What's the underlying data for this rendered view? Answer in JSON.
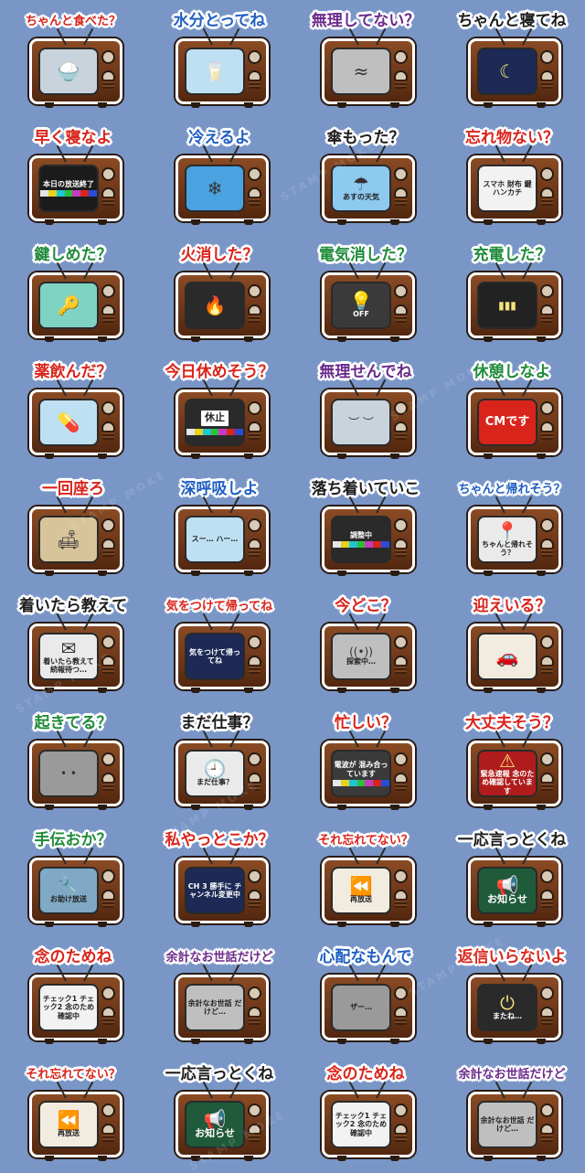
{
  "watermark": "STAMP MOKE",
  "colors": {
    "background": "#7996c7",
    "tv_body": "#6b3618",
    "caption_red": "#d9241b",
    "caption_blue": "#1f5fc2",
    "caption_green": "#1f8a3a",
    "caption_purple": "#6a2a8a"
  },
  "stickers": [
    {
      "caption": "ちゃんと食べた？",
      "accent": "#d9241b",
      "screen_bg": "#c9d3dc",
      "screen_icon": "rice-bowl-icon",
      "glyph": "🍚",
      "screen_text": ""
    },
    {
      "caption": "水分とってね",
      "accent": "#1f5fc2",
      "screen_bg": "#bfe0f2",
      "screen_icon": "water-glass-icon",
      "glyph": "🥛",
      "screen_text": ""
    },
    {
      "caption": "無理してない？",
      "accent": "#6a2a8a",
      "screen_bg": "#bfbfbf",
      "screen_icon": "worried-face-icon",
      "glyph": "≈",
      "screen_text": ""
    },
    {
      "caption": "ちゃんと寝てね",
      "accent": "#1d1d1d",
      "screen_bg": "#1c2a55",
      "screen_icon": "moon-icon",
      "glyph": "☾",
      "screen_text": ""
    },
    {
      "caption": "早く寝なよ",
      "accent": "#d9241b",
      "screen_bg": "#1b1b1b",
      "screen_icon": "broadcast-end-icon",
      "glyph": "",
      "screen_text": "本日の放送終了"
    },
    {
      "caption": "冷えるよ",
      "accent": "#1f5fc2",
      "screen_bg": "#4aa3e0",
      "screen_icon": "snowflake-icon",
      "glyph": "❄",
      "screen_text": ""
    },
    {
      "caption": "傘もった？",
      "accent": "#1d1d1d",
      "screen_bg": "#8ec9ef",
      "screen_icon": "umbrella-weather-icon",
      "glyph": "☂",
      "screen_text": "あすの天気"
    },
    {
      "caption": "忘れ物ない？",
      "accent": "#d9241b",
      "screen_bg": "#f2f2f2",
      "screen_icon": "checklist-icon",
      "glyph": "",
      "screen_text": "スマホ 財布 鍵 ハンカチ"
    },
    {
      "caption": "鍵しめた？",
      "accent": "#1f8a3a",
      "screen_bg": "#7fd3c3",
      "screen_icon": "key-icon",
      "glyph": "🔑",
      "screen_text": ""
    },
    {
      "caption": "火消した？",
      "accent": "#d9241b",
      "screen_bg": "#2a2a2a",
      "screen_icon": "gas-flame-icon",
      "glyph": "🔥",
      "screen_text": ""
    },
    {
      "caption": "電気消した？",
      "accent": "#1f8a3a",
      "screen_bg": "#3a3a3a",
      "screen_icon": "ceiling-lamp-icon",
      "glyph": "💡",
      "screen_text": "OFF"
    },
    {
      "caption": "充電した？",
      "accent": "#1f8a3a",
      "screen_bg": "#222222",
      "screen_icon": "battery-icon",
      "glyph": "▮▮▮",
      "screen_text": ""
    },
    {
      "caption": "薬飲んだ？",
      "accent": "#d9241b",
      "screen_bg": "#bfe0f2",
      "screen_icon": "medicine-icon",
      "glyph": "💊",
      "screen_text": ""
    },
    {
      "caption": "今日休めそう？",
      "accent": "#d9241b",
      "screen_bg": "#2a2a2a",
      "screen_icon": "rest-sign-icon",
      "glyph": "",
      "screen_text": "休止"
    },
    {
      "caption": "無理せんでね",
      "accent": "#6a2a8a",
      "screen_bg": "#c9d3dc",
      "screen_icon": "calm-face-icon",
      "glyph": "︶ ︶",
      "screen_text": ""
    },
    {
      "caption": "休憩しなよ",
      "accent": "#1f8a3a",
      "screen_bg": "#d9241b",
      "screen_icon": "commercial-icon",
      "glyph": "",
      "screen_text": "CMです"
    },
    {
      "caption": "一回座ろ",
      "accent": "#d9241b",
      "screen_bg": "#d8c49a",
      "screen_icon": "sofa-icon",
      "glyph": "🛋",
      "screen_text": ""
    },
    {
      "caption": "深呼吸しよ",
      "accent": "#1f5fc2",
      "screen_bg": "#bfe0f2",
      "screen_icon": "breathing-face-icon",
      "glyph": "",
      "screen_text": "スー… ハー…"
    },
    {
      "caption": "落ち着いていこ",
      "accent": "#1d1d1d",
      "screen_bg": "#2a2a2a",
      "screen_icon": "adjusting-icon",
      "glyph": "",
      "screen_text": "調整中"
    },
    {
      "caption": "ちゃんと帰れそう？",
      "accent": "#1f5fc2",
      "screen_bg": "#eaeaea",
      "screen_icon": "map-icon",
      "glyph": "📍",
      "screen_text": "ちゃんと帰れそう？"
    },
    {
      "caption": "着いたら教えて",
      "accent": "#1d1d1d",
      "screen_bg": "#eaeaea",
      "screen_icon": "mail-icon",
      "glyph": "✉",
      "screen_text": "着いたら教えて 続報待つ…"
    },
    {
      "caption": "気をつけて帰ってね",
      "accent": "#d9241b",
      "screen_bg": "#1c2a55",
      "screen_icon": "news-night-icon",
      "glyph": "",
      "screen_text": "気をつけて帰ってね"
    },
    {
      "caption": "今どこ？",
      "accent": "#d9241b",
      "screen_bg": "#bfbfbf",
      "screen_icon": "signal-icon",
      "glyph": "((•))",
      "screen_text": "探索中…"
    },
    {
      "caption": "迎えいる？",
      "accent": "#d9241b",
      "screen_bg": "#f2ece0",
      "screen_icon": "car-icon",
      "glyph": "🚗",
      "screen_text": ""
    },
    {
      "caption": "起きてる？",
      "accent": "#1f8a3a",
      "screen_bg": "#9a9a9a",
      "screen_icon": "eyes-icon",
      "glyph": "• •",
      "screen_text": ""
    },
    {
      "caption": "まだ仕事？",
      "accent": "#1d1d1d",
      "screen_bg": "#eaeaea",
      "screen_icon": "clock-icon",
      "glyph": "🕘",
      "screen_text": "まだ仕事？"
    },
    {
      "caption": "忙しい？",
      "accent": "#d9241b",
      "screen_bg": "#3a3a3a",
      "screen_icon": "bad-signal-icon",
      "glyph": "",
      "screen_text": "電波が 混み合っています"
    },
    {
      "caption": "大丈夫そう？",
      "accent": "#d9241b",
      "screen_bg": "#b01b1b",
      "screen_icon": "emergency-icon",
      "glyph": "⚠",
      "screen_text": "緊急速報 念のため確認しています"
    },
    {
      "caption": "手伝おか？",
      "accent": "#1f8a3a",
      "screen_bg": "#7fa9c4",
      "screen_icon": "wrench-icon",
      "glyph": "🔧",
      "screen_text": "お助け放送"
    },
    {
      "caption": "私やっとこか？",
      "accent": "#d9241b",
      "screen_bg": "#1c2a55",
      "screen_icon": "channel-icon",
      "glyph": "",
      "screen_text": "CH 3 勝手に チャンネル変更中"
    },
    {
      "caption": "それ忘れてない？",
      "accent": "#d9241b",
      "screen_bg": "#f2ece0",
      "screen_icon": "rewind-icon",
      "glyph": "⏪",
      "screen_text": "再放送"
    },
    {
      "caption": "一応言っとくね",
      "accent": "#1d1d1d",
      "screen_bg": "#1f5a3a",
      "screen_icon": "megaphone-icon",
      "glyph": "📢",
      "screen_text": "お知らせ"
    },
    {
      "caption": "念のためね",
      "accent": "#d9241b",
      "screen_bg": "#f2f2f2",
      "screen_icon": "checkbox-icon",
      "glyph": "",
      "screen_text": "チェック1 チェック2 念のため確認中"
    },
    {
      "caption": "余計なお世話だけど",
      "accent": "#6a2a8a",
      "screen_bg": "#bfbfbf",
      "screen_icon": "static-icon",
      "glyph": "",
      "screen_text": "余計なお世話 だけど…"
    },
    {
      "caption": "心配なもんで",
      "accent": "#1f5fc2",
      "screen_bg": "#9a9a9a",
      "screen_icon": "noise-icon",
      "glyph": "",
      "screen_text": "ザー…"
    },
    {
      "caption": "返信いらないよ",
      "accent": "#d9241b",
      "screen_bg": "#2a2a2a",
      "screen_icon": "power-icon",
      "glyph": "⏻",
      "screen_text": "またね…"
    },
    {
      "caption": "それ忘れてない？",
      "accent": "#d9241b",
      "screen_bg": "#f2ece0",
      "screen_icon": "rewind-icon",
      "glyph": "⏪",
      "screen_text": "再放送"
    },
    {
      "caption": "一応言っとくね",
      "accent": "#1d1d1d",
      "screen_bg": "#1f5a3a",
      "screen_icon": "megaphone-icon",
      "glyph": "📢",
      "screen_text": "お知らせ"
    },
    {
      "caption": "念のためね",
      "accent": "#d9241b",
      "screen_bg": "#f2f2f2",
      "screen_icon": "checkbox-icon",
      "glyph": "",
      "screen_text": "チェック1 チェック2 念のため確認中"
    },
    {
      "caption": "余計なお世話だけど",
      "accent": "#6a2a8a",
      "screen_bg": "#bfbfbf",
      "screen_icon": "static-icon",
      "glyph": "",
      "screen_text": "余計なお世話 だけど…"
    }
  ]
}
